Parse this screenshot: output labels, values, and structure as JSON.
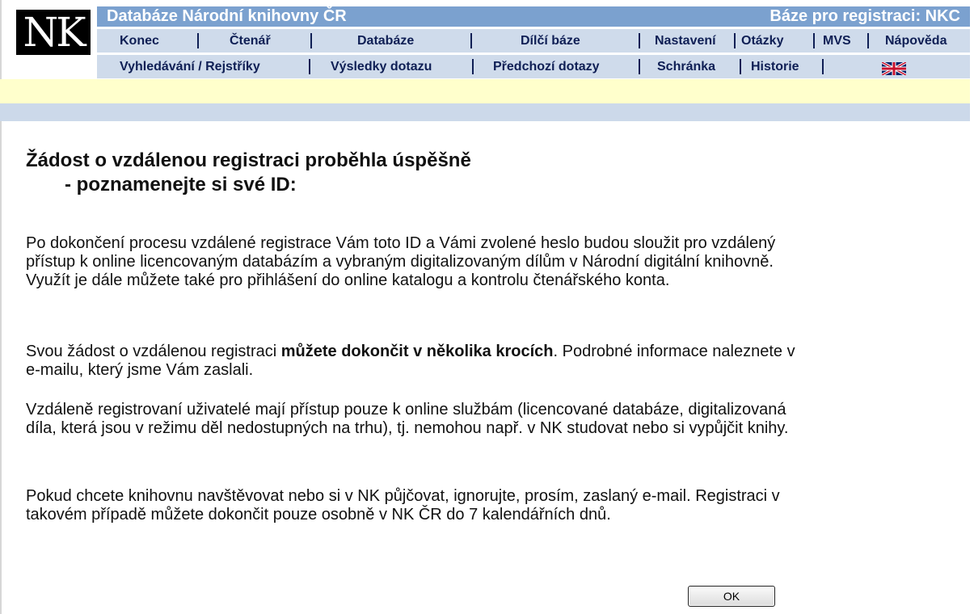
{
  "header": {
    "logo": "NK",
    "title": "Databáze Národní knihovny ČR",
    "base_label": "Báze pro registraci:  NKC"
  },
  "nav_primary": {
    "konec": "Konec",
    "ctenar": "Čtenář",
    "databaze": "Databáze",
    "dilci_baze": "Dílčí báze",
    "nastaveni": "Nastavení",
    "otazky": "Otázky",
    "mvs": "MVS",
    "napoveda": "Nápověda"
  },
  "nav_secondary": {
    "vyhledavani": "Vyhledávání / Rejstříky",
    "vysledky": "Výsledky dotazu",
    "predchozi": "Předchozí dotazy",
    "schranka": "Schránka",
    "historie": "Historie",
    "language_flag": "uk-flag-icon"
  },
  "content": {
    "heading_line1": "Žádost o vzdálenou registraci proběhla úspěšně",
    "heading_line2": "- poznamenejte si své ID:",
    "p1": "Po dokončení procesu vzdálené registrace Vám toto ID a Vámi zvolené heslo budou sloužit pro vzdálený přístup k online licencovaným databázím a vybraným digitalizovaným dílům v Národní digitální knihovně. Využít je dále můžete také pro přihlášení do online katalogu a kontrolu čtenářského konta.",
    "p2_before": "Svou žádost o vzdálenou registraci ",
    "p2_bold": "můžete dokončit v několika krocích",
    "p2_after": ". Podrobné informace naleznete v e-mailu, který jsme Vám zaslali.",
    "p3": "Vzdáleně registrovaní uživatelé mají přístup pouze k online službám (licencované databáze, digitalizovaná díla, která jsou v režimu děl nedostupných na trhu), tj. nemohou např. v NK studovat nebo si vypůjčit knihy.",
    "p4": "Pokud chcete knihovnu navštěvovat nebo si v NK půjčovat, ignorujte, prosím, zaslaný e-mail. Registraci v takovém případě můžete dokončit pouze osobně v NK ČR do 7 kalendářních dnů.",
    "ok_label": "OK"
  },
  "colors": {
    "title_bar": "#7ba1cf",
    "nav_bar": "#cfdbeb",
    "nav_text": "#0f1f55",
    "yellow_band": "#ffffcc",
    "blue_strip": "#ccd9ea"
  }
}
